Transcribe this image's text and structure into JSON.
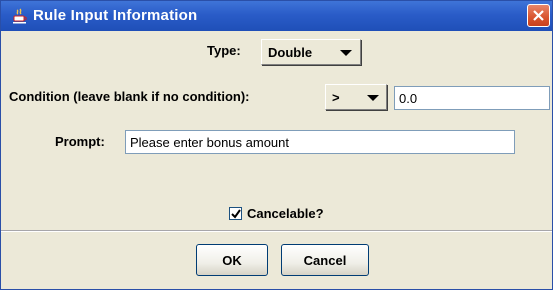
{
  "window": {
    "title": "Rule Input Information",
    "close_icon": "close-icon"
  },
  "form": {
    "type_label": "Type:",
    "type_value": "Double",
    "condition_label": "Condition (leave blank if no condition):",
    "condition_operator": ">",
    "condition_value": "0.0",
    "prompt_label": "Prompt:",
    "prompt_value": "Please enter bonus amount",
    "cancelable_label": "Cancelable?",
    "cancelable_checked": true
  },
  "buttons": {
    "ok": "OK",
    "cancel": "Cancel"
  }
}
